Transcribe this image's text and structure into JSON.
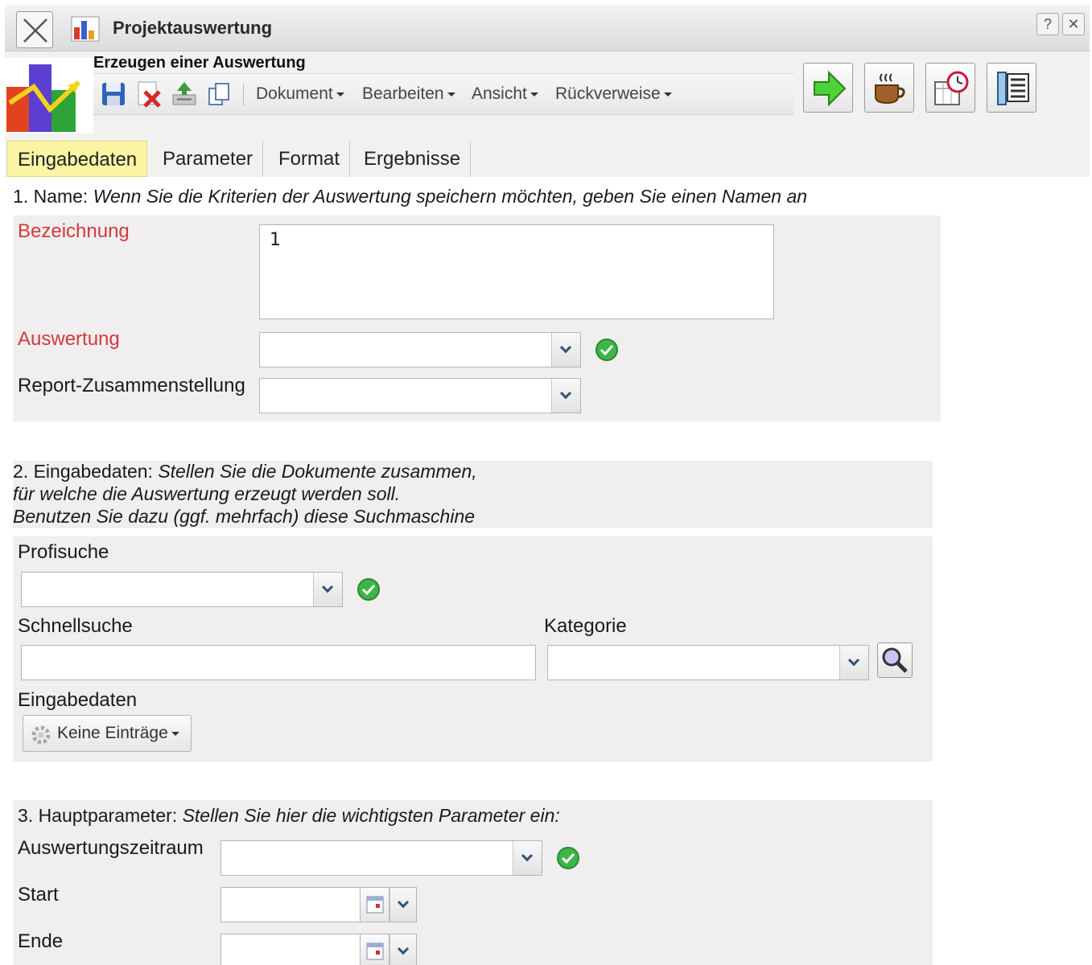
{
  "window": {
    "title": "Projektauswertung",
    "help_label": "?",
    "close_label": "✕"
  },
  "header": {
    "subtitle": "Erzeugen einer Auswertung",
    "menus": [
      {
        "label": "Dokument"
      },
      {
        "label": "Bearbeiten"
      },
      {
        "label": "Ansicht"
      },
      {
        "label": "Rückverweise"
      }
    ],
    "toolbar_icons": [
      "save-icon",
      "delete-icon",
      "export-icon",
      "copy-icon"
    ],
    "action_buttons": [
      "run-arrow-icon",
      "coffee-icon",
      "calendar-clock-icon",
      "ruler-list-icon"
    ]
  },
  "tabs": [
    {
      "label": "Eingabedaten",
      "active": true
    },
    {
      "label": "Parameter",
      "active": false
    },
    {
      "label": "Format",
      "active": false
    },
    {
      "label": "Ergebnisse",
      "active": false
    }
  ],
  "section1": {
    "title_prefix": "1. Name: ",
    "title_hint": "Wenn Sie die Kriterien der Auswertung speichern möchten, geben Sie einen Namen an",
    "bezeichnung_label": "Bezeichnung",
    "bezeichnung_value": "1",
    "auswertung_label": "Auswertung",
    "auswertung_value": "",
    "report_label": "Report-Zusammenstellung",
    "report_value": ""
  },
  "section2": {
    "title_prefix": "2. Eingabedaten: ",
    "title_hint_line1": "Stellen Sie die Dokumente zusammen,",
    "title_hint_line2": "für welche die Auswertung erzeugt werden soll.",
    "title_hint_line3": "Benutzen Sie dazu (ggf. mehrfach) diese Suchmaschine",
    "profisuche_label": "Profisuche",
    "profisuche_value": "",
    "schnellsuche_label": "Schnellsuche",
    "schnellsuche_value": "",
    "kategorie_label": "Kategorie",
    "kategorie_value": "",
    "eingabedaten_label": "Eingabedaten",
    "entries_button": "Keine Einträge"
  },
  "section3": {
    "title_prefix": "3. Hauptparameter: ",
    "title_hint": "Stellen Sie hier die wichtigsten Parameter ein:",
    "zeitraum_label": "Auswertungszeitraum",
    "zeitraum_value": "",
    "start_label": "Start",
    "start_value": "",
    "ende_label": "Ende",
    "ende_value": ""
  },
  "colors": {
    "required_label": "#d23a3a",
    "active_tab": "#fcf6a4",
    "panel_bg": "#f0eeee"
  }
}
